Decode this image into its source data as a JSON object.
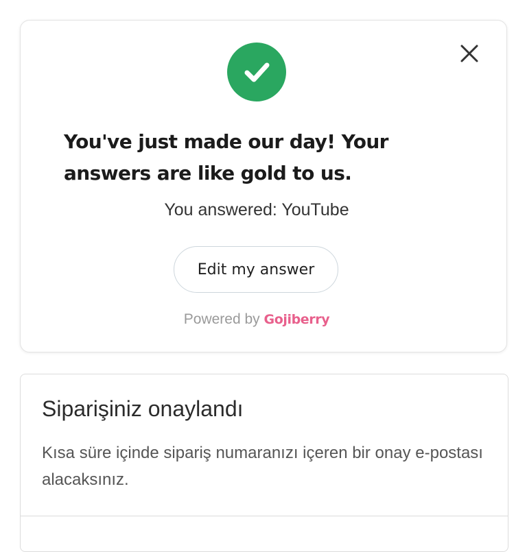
{
  "survey": {
    "title": "You've just made our day! Your answers are like gold to us.",
    "answered_text": "You answered: YouTube",
    "edit_button_label": "Edit my answer",
    "powered_by_prefix": "Powered by ",
    "powered_by_brand": "Gojiberry",
    "icons": {
      "success": "checkmark-icon",
      "close": "close-icon"
    },
    "colors": {
      "success": "#2aa760",
      "brand": "#e8608c"
    }
  },
  "order": {
    "title": "Siparişiniz onaylandı",
    "message": "Kısa süre içinde sipariş numaranızı içeren bir onay e-postası alacaksınız."
  }
}
